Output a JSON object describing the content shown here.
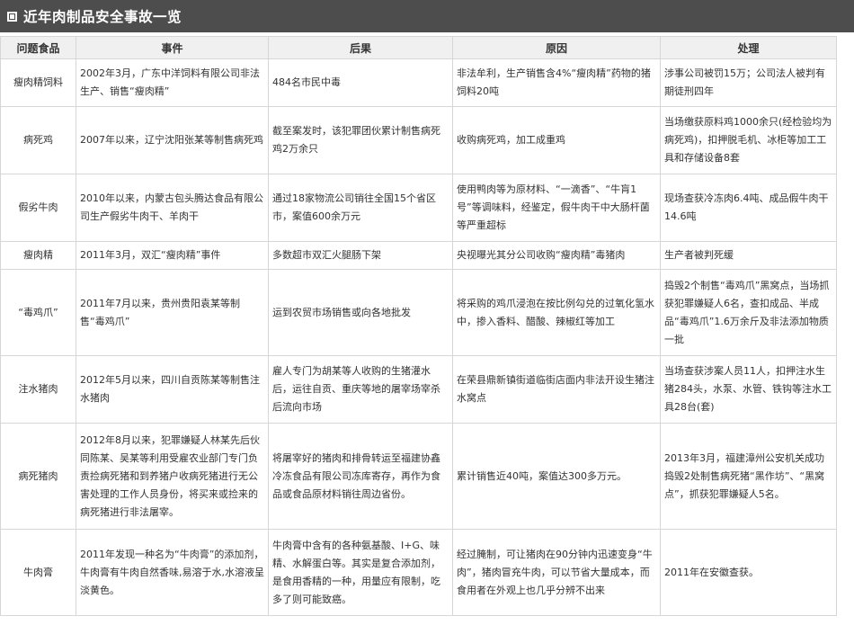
{
  "title": "近年肉制品安全事故一览",
  "columns": [
    "问题食品",
    "事件",
    "后果",
    "原因",
    "处理"
  ],
  "rows": [
    {
      "food": "瘦肉精饲料",
      "event": "2002年3月，广东中洋饲料有限公司非法生产、销售“瘦肉精”",
      "result": "484名市民中毒",
      "cause": "非法牟利，生产销售含4%“瘦肉精”药物的猪饲料20吨",
      "handling": "涉事公司被罚15万；公司法人被判有期徒刑四年"
    },
    {
      "food": "病死鸡",
      "event": "2007年以来，辽宁沈阳张某等制售病死鸡",
      "result": "截至案发时，该犯罪团伙累计制售病死鸡2万余只",
      "cause": "收购病死鸡，加工成重鸡",
      "handling": "当场缴获原料鸡1000余只(经检验均为病死鸡)，扣押脱毛机、冰柜等加工工具和存储设备8套"
    },
    {
      "food": "假劣牛肉",
      "event": "2010年以来，内蒙古包头腾达食品有限公司生产假劣牛肉干、羊肉干",
      "result": "通过18家物流公司销往全国15个省区市，案值600余万元",
      "cause": "使用鸭肉等为原材料、“一滴香”、“牛肓1号”等调味料，经鉴定，假牛肉干中大肠杆菌等严重超标",
      "handling": "现场查获冷冻肉6.4吨、成品假牛肉干14.6吨"
    },
    {
      "food": "瘦肉精",
      "event": "2011年3月，双汇“瘦肉精”事件",
      "result": "多数超市双汇火腿肠下架",
      "cause": "央视曝光其分公司收购“瘦肉精”毒猪肉",
      "handling": "生产者被判死缓"
    },
    {
      "food": "“毒鸡爪”",
      "event": "2011年7月以来，贵州贵阳袁某等制售“毒鸡爪”",
      "result": "运到农贸市场销售或向各地批发",
      "cause": "将采购的鸡爪浸泡在按比例勾兑的过氧化氢水中，掺入香料、醋酸、辣椒红等加工",
      "handling": "捣毁2个制售“毒鸡爪”黑窝点，当场抓获犯罪嫌疑人6名，查扣成品、半成品“毒鸡爪”1.6万余斤及非法添加物质一批"
    },
    {
      "food": "注水猪肉",
      "event": "2012年5月以来，四川自贡陈某等制售注水猪肉",
      "result": "雇人专门为胡某等人收购的生猪灌水",
      "result2": "后，运往自贡、重庆等地的屠宰场宰杀后流向市场",
      "cause": "在荣县鼎新镇街道临街店面内非法开设生猪注水窝点",
      "handling": "当场查获涉案人员11人，扣押注水生猪284头，水泵、水管、铁钩等注水工具28台(套)"
    },
    {
      "food": "病死猪肉",
      "event": "2012年8月以来，犯罪嫌疑人林某先后伙同陈某、吴某等利用受雇农业部门专门负责捡病死猪和到养猪户收病死猪进行无公害处理的工作人员身份，将买来或捡来的病死猪进行非法屠宰。",
      "result": "将屠宰好的猪肉和排骨转运至福建协鑫冷冻食品有限公司冻库寄存，再作为食品或食品原材料销往周边省份。",
      "cause": "累计销售近40吨，案值达300多万元。",
      "handling": "2013年3月，福建漳州公安机关成功捣毁2处制售病死猪“黑作坊”、“黑窝点”，抓获犯罪嫌疑人5名。"
    },
    {
      "food": "牛肉膏",
      "event": "2011年发现一种名为“牛肉膏”的添加剂，牛肉膏有牛肉自然香味,易溶于水,水溶液呈淡黄色。",
      "result": "牛肉膏中含有的各种氨基酸、I+G、味精、水解蛋白等。其实是复合添加剂，是食用香精的一种，用量应有限制，吃多了则可能致癌。",
      "cause": "经过腌制，可让猪肉在90分钟内迅速变身“牛肉”，猪肉冒充牛肉，可以节省大量成本，而食用者在外观上也几乎分辨不出来",
      "handling": "2011年在安徽查获。"
    }
  ]
}
